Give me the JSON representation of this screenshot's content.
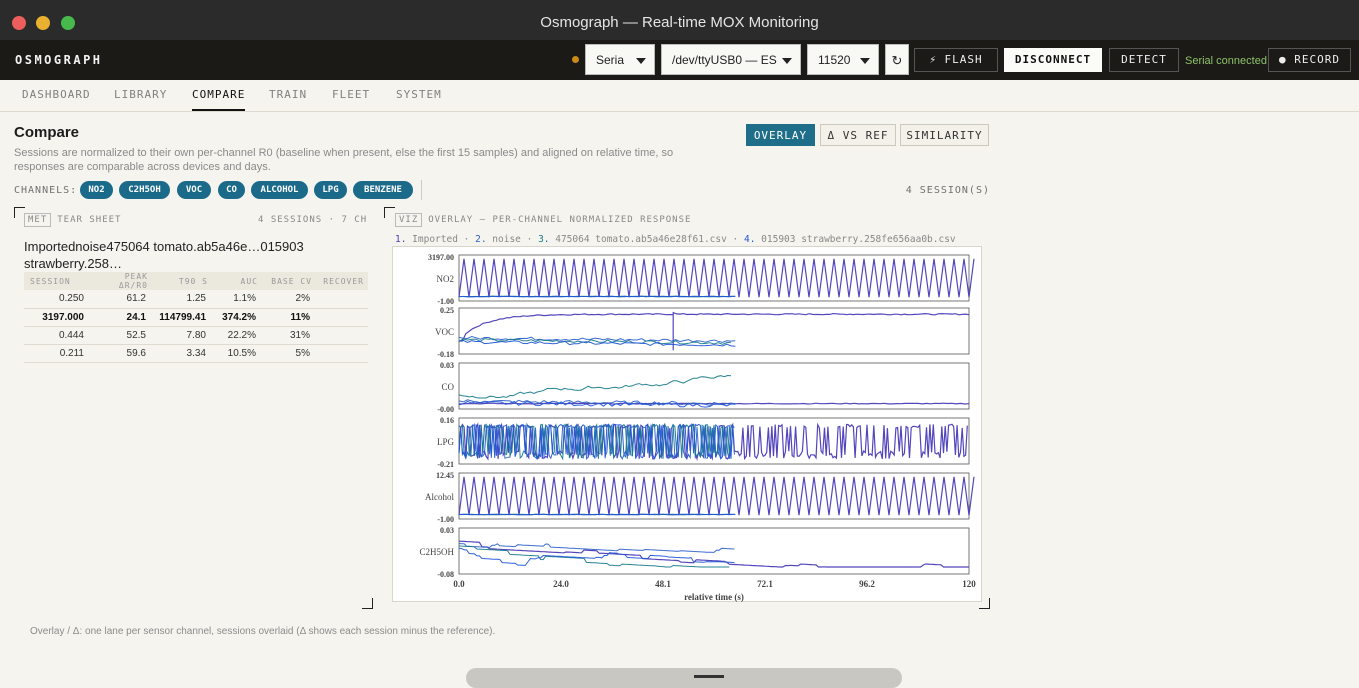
{
  "window": {
    "title": "Osmograph — Real-time MOX Monitoring"
  },
  "header": {
    "brand": "OSMOGRAPH",
    "transport": "Seria",
    "port": "/dev/ttyUSB0 — ES",
    "baud": "11520",
    "refresh_icon": "↻",
    "flash": "⚡ FLASH",
    "disconnect": "DISCONNECT",
    "detect": "DETECT",
    "serial_status": "Serial connected",
    "record": "● RECORD",
    "colors": {
      "status": "#8ec26a",
      "dot": "#c98a18"
    }
  },
  "nav": {
    "tabs": [
      "DASHBOARD",
      "LIBRARY",
      "COMPARE",
      "TRAIN",
      "FLEET",
      "SYSTEM"
    ],
    "active": "COMPARE"
  },
  "compare": {
    "title": "Compare",
    "description": "Sessions are normalized to their own per-channel R0 (baseline when present, else the first 15 samples) and aligned on relative time, so responses are comparable across devices and days.",
    "modes": [
      "OVERLAY",
      "Δ VS REF",
      "SIMILARITY"
    ],
    "active_mode": "OVERLAY",
    "channels_label": "CHANNELS:",
    "channels": [
      "NO2",
      "C2H5OH",
      "VOC",
      "CO",
      "ALCOHOL",
      "LPG",
      "BENZENE"
    ],
    "session_count": "4 SESSION(S)",
    "footnote": "Overlay / Δ: one lane per sensor channel, sessions overlaid (Δ shows each session minus the reference)."
  },
  "tear_sheet": {
    "tag": "MET",
    "label": "TEAR SHEET",
    "meta": "4 SESSIONS · 7 CH",
    "title": "Importednoise475064 tomato.ab5a46e…015903 strawberry.258…",
    "columns": [
      "SESSION",
      "PEAK ΔR/R0",
      "T90 S",
      "AUC",
      "BASE CV",
      "RECOVER"
    ],
    "rows": [
      {
        "session": "0.250",
        "peak": "61.2",
        "t90": "1.25",
        "auc": "1.1%",
        "base_cv": "2%",
        "recover": "",
        "bold": false
      },
      {
        "session": "3197.000",
        "peak": "24.1",
        "t90": "114799.41",
        "auc": "374.2%",
        "base_cv": "11%",
        "recover": "",
        "bold": true
      },
      {
        "session": "0.444",
        "peak": "52.5",
        "t90": "7.80",
        "auc": "22.2%",
        "base_cv": "31%",
        "recover": "",
        "bold": false
      },
      {
        "session": "0.211",
        "peak": "59.6",
        "t90": "3.34",
        "auc": "10.5%",
        "base_cv": "5%",
        "recover": "",
        "bold": false
      }
    ]
  },
  "viz": {
    "tag": "VIZ",
    "label": "OVERLAY — PER-CHANNEL NORMALIZED RESPONSE",
    "legend": [
      {
        "num": "1.",
        "name": "Imported",
        "color": "#4a3cb8"
      },
      {
        "num": "2.",
        "name": "noise",
        "color": "#2f62c9"
      },
      {
        "num": "3.",
        "name": "475064 tomato.ab5a46e28f61.csv",
        "color": "#1a7c8c"
      },
      {
        "num": "4.",
        "name": "015903 strawberry.258fe656aa0b.csv",
        "color": "#2257d6"
      }
    ]
  },
  "chart_data": {
    "type": "line",
    "xlabel": "relative time (s)",
    "xlim": [
      0,
      120
    ],
    "xticks": [
      "0.0",
      "24.0",
      "48.1",
      "72.1",
      "96.2",
      "120"
    ],
    "lanes": [
      {
        "name": "NO2",
        "ymax": "3197.00",
        "ymin": "-1.00",
        "pattern": "periodic",
        "ylim": [
          -1,
          3197
        ]
      },
      {
        "name": "VOC",
        "ymax": "0.25",
        "ymin": "-0.18",
        "pattern": "rise",
        "ylim": [
          -0.18,
          0.25
        ]
      },
      {
        "name": "CO",
        "ymax": "0.03",
        "ymin": "-0.00",
        "pattern": "wander",
        "ylim": [
          -0.005,
          0.03
        ]
      },
      {
        "name": "LPG",
        "ymax": "0.16",
        "ymin": "-0.21",
        "pattern": "dense",
        "ylim": [
          -0.21,
          0.16
        ]
      },
      {
        "name": "Alcohol",
        "ymax": "12.45",
        "ymin": "-1.00",
        "pattern": "periodic",
        "ylim": [
          -1,
          12.45
        ]
      },
      {
        "name": "C2H5OH",
        "ymax": "0.03",
        "ymin": "-0.08",
        "pattern": "steps",
        "ylim": [
          -0.08,
          0.03
        ]
      }
    ],
    "series": [
      {
        "name": "Imported",
        "color": "#4a3cb8",
        "duration": 120
      },
      {
        "name": "noise",
        "color": "#2f62c9",
        "duration": 65
      },
      {
        "name": "475064 tomato.ab5a46e28f61.csv",
        "color": "#1a7c8c",
        "duration": 64
      },
      {
        "name": "015903 strawberry.258fe656aa0b.csv",
        "color": "#2257d6",
        "duration": 65
      }
    ]
  }
}
